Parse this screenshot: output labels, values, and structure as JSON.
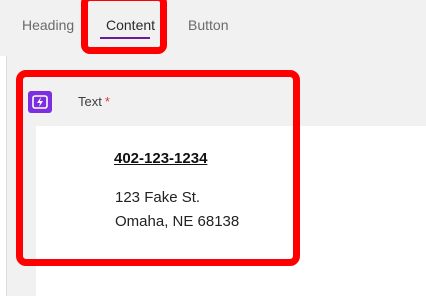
{
  "tabs": [
    {
      "label": "Heading"
    },
    {
      "label": "Content"
    },
    {
      "label": "Button"
    }
  ],
  "active_tab": "Content",
  "field": {
    "icon": "lightning-bolt-icon",
    "label": "Text",
    "required_marker": "*"
  },
  "content": {
    "phone": "402-123-1234",
    "address_line1": "123 Fake St.",
    "address_line2": "Omaha, NE 68138"
  },
  "colors": {
    "accent": "#6a1b9a",
    "icon_bg": "#7b2fe0",
    "highlight": "#ff0000",
    "required": "#e53935"
  }
}
